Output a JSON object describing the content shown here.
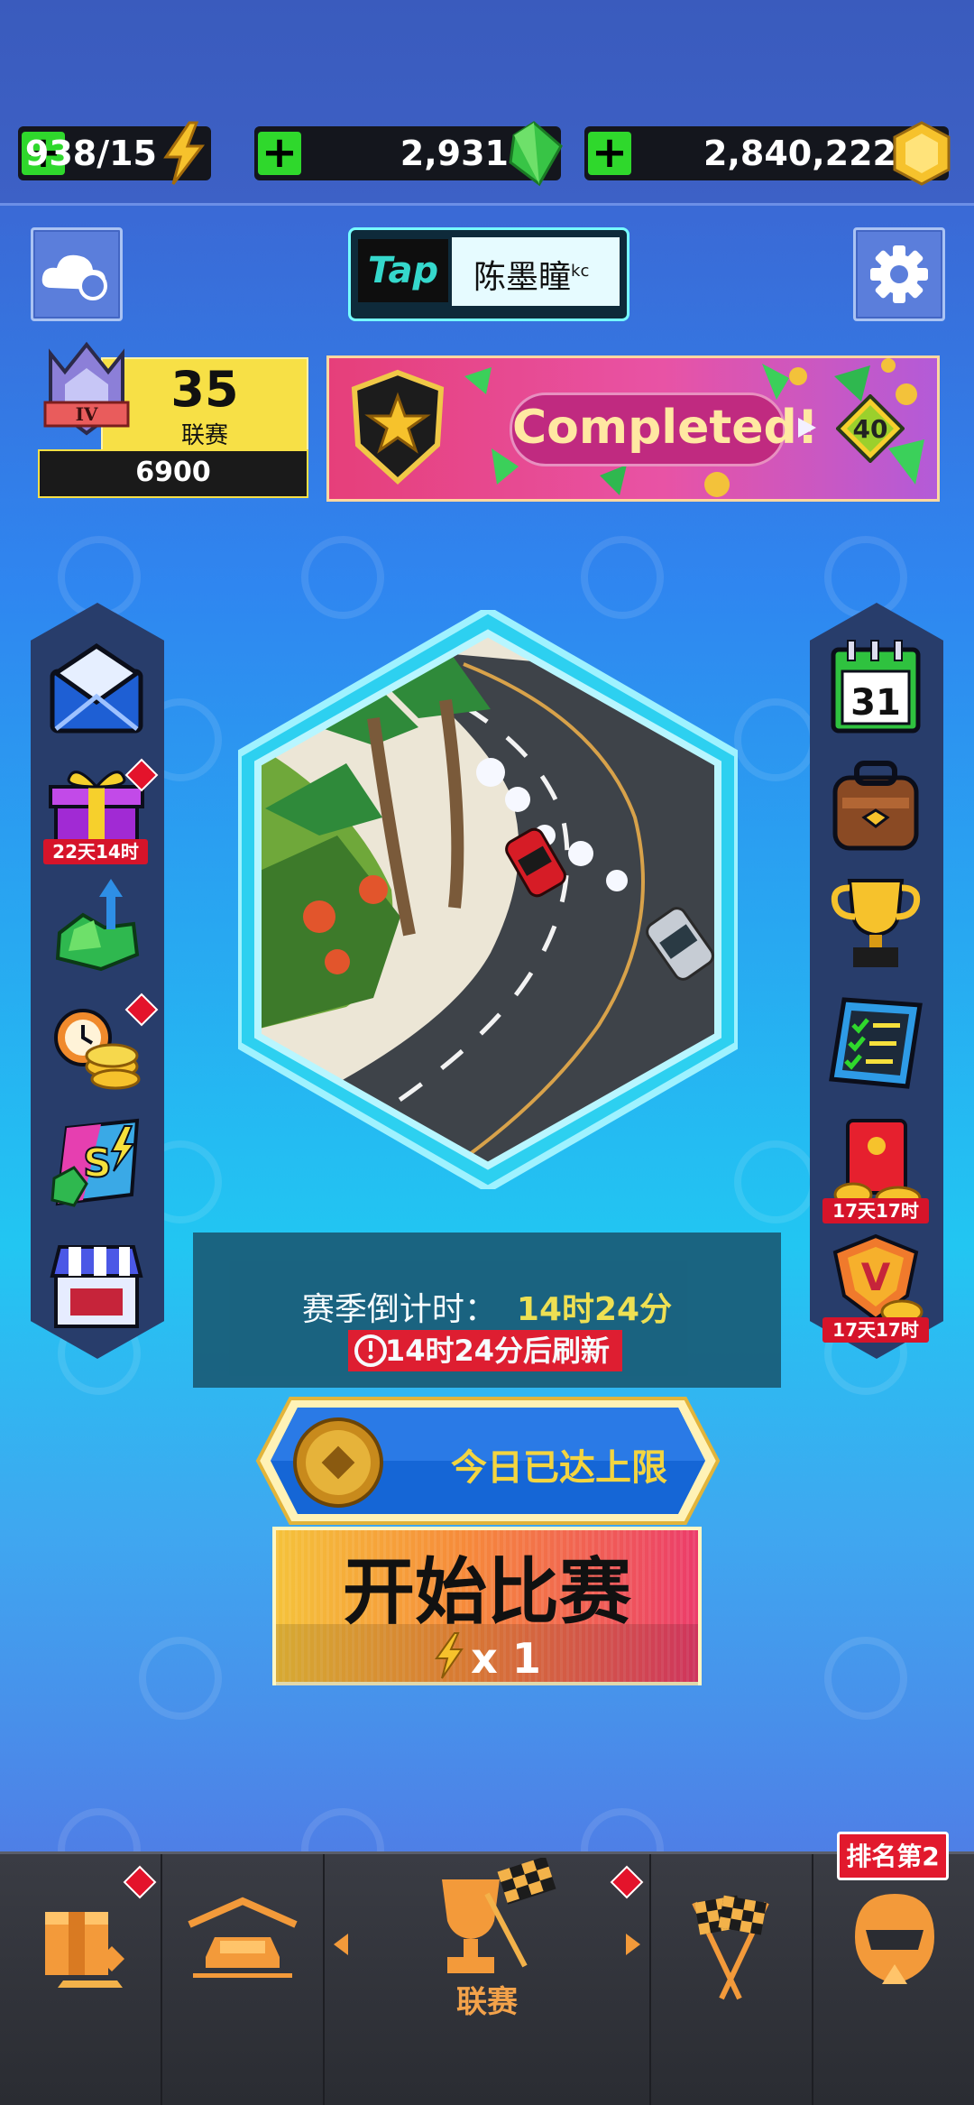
{
  "currencies": {
    "energy": {
      "value": "938/15",
      "icon": "lightning-icon"
    },
    "gems": {
      "value": "2,931",
      "icon": "green-gem-icon"
    },
    "coins": {
      "value": "2,840,222",
      "icon": "gold-coin-icon"
    },
    "add_label": "+"
  },
  "profile": {
    "logo": "Tap",
    "name": "陈墨瞳",
    "suffix": "kc"
  },
  "league": {
    "rank_roman": "IV",
    "number": "35",
    "label": "联赛",
    "score": "6900"
  },
  "banner": {
    "text": "Completed!",
    "level": "40"
  },
  "left_sidebar": {
    "items": [
      {
        "icon": "mail-icon"
      },
      {
        "icon": "gift-icon",
        "timer": "22天14时",
        "badge": true
      },
      {
        "icon": "gem-upgrade-icon"
      },
      {
        "icon": "timed-coins-icon",
        "badge": true
      },
      {
        "icon": "season-pass-icon"
      },
      {
        "icon": "shop-icon"
      }
    ]
  },
  "right_sidebar": {
    "items": [
      {
        "icon": "calendar-icon",
        "day": "31"
      },
      {
        "icon": "backpack-icon"
      },
      {
        "icon": "trophy-icon"
      },
      {
        "icon": "checklist-icon"
      },
      {
        "icon": "red-envelope-icon",
        "timer": "17天17时"
      },
      {
        "icon": "vip-icon",
        "timer": "17天17时"
      }
    ]
  },
  "season": {
    "label": "赛季倒计时：",
    "time": "14时24分",
    "refresh": "14时24分后刷新"
  },
  "limit_button": {
    "label": "今日已达上限"
  },
  "start_button": {
    "label": "开始比赛",
    "cost": "x 1"
  },
  "bottom_nav": {
    "items": [
      {
        "name": "store",
        "icon": "crate-icon",
        "badge": true
      },
      {
        "name": "garage",
        "icon": "garage-car-icon"
      },
      {
        "name": "league",
        "icon": "trophy-flag-icon",
        "label": "联赛",
        "badge": true
      },
      {
        "name": "race",
        "icon": "checkered-flags-icon"
      },
      {
        "name": "rank",
        "icon": "helmet-icon",
        "rank_label": "排名第2"
      }
    ]
  },
  "colors": {
    "accent_green": "#2fd82c",
    "badge_red": "#e4132b",
    "gold": "#f3d540"
  }
}
